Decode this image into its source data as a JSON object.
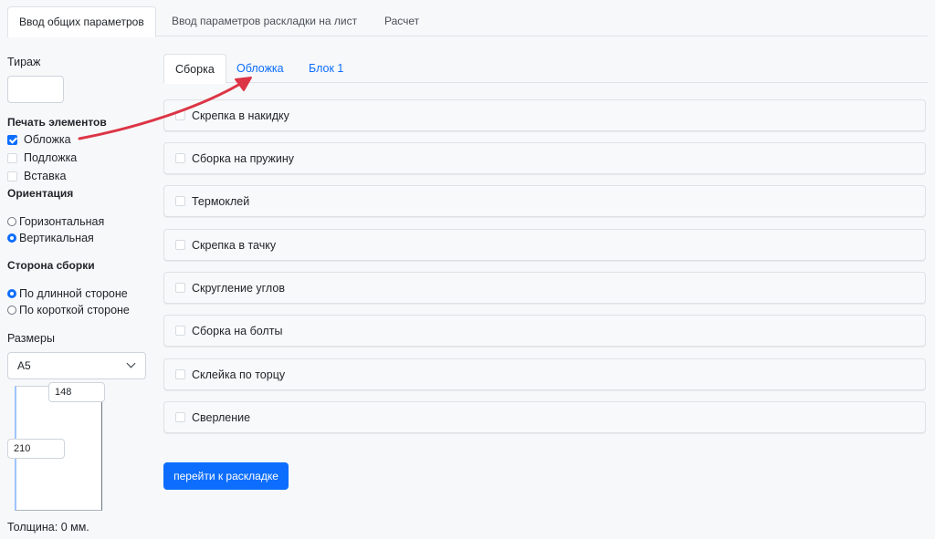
{
  "top_tabs": [
    {
      "label": "Ввод общих параметров",
      "active": true
    },
    {
      "label": "Ввод параметров раскладки на лист",
      "active": false
    },
    {
      "label": "Расчет",
      "active": false
    }
  ],
  "left_panel": {
    "run_label": "Тираж",
    "run_value": "",
    "print_elements_title": "Печать элементов",
    "print_elements": [
      {
        "label": "Обложка",
        "checked": true
      },
      {
        "label": "Подложка",
        "checked": false
      },
      {
        "label": "Вставка",
        "checked": false
      }
    ],
    "orientation_title": "Ориентация",
    "orientation_options": [
      {
        "label": "Горизонтальная",
        "selected": false
      },
      {
        "label": "Вертикальная",
        "selected": true
      }
    ],
    "binding_side_title": "Сторона сборки",
    "binding_side_options": [
      {
        "label": "По длинной стороне",
        "selected": true
      },
      {
        "label": "По короткой стороне",
        "selected": false
      }
    ],
    "sizes_label": "Размеры",
    "size_selected": "A5",
    "width_value": "148",
    "height_value": "210",
    "thickness_text": "Толщина: 0 мм."
  },
  "sub_tabs": [
    {
      "label": "Сборка",
      "active": true
    },
    {
      "label": "Обложка",
      "active": false
    },
    {
      "label": "Блок 1",
      "active": false
    }
  ],
  "assembly_options": [
    {
      "label": "Скрепка в накидку",
      "checked": false
    },
    {
      "label": "Сборка на пружину",
      "checked": false
    },
    {
      "label": "Термоклей",
      "checked": false
    },
    {
      "label": "Скрепка в тачку",
      "checked": false
    },
    {
      "label": "Скругление углов",
      "checked": false
    },
    {
      "label": "Сборка на болты",
      "checked": false
    },
    {
      "label": "Склейка по торцу",
      "checked": false
    },
    {
      "label": "Сверление",
      "checked": false
    }
  ],
  "proceed_button_label": "перейти к раскладке",
  "colors": {
    "accent": "#0d6efd",
    "annotation_arrow": "#dc3545"
  }
}
